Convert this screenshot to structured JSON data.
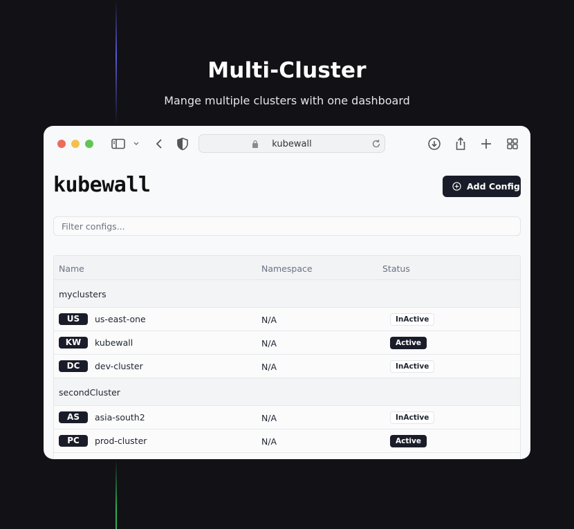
{
  "hero": {
    "title": "Multi-Cluster",
    "subtitle": "Mange multiple clusters with one dashboard"
  },
  "browser": {
    "url": "kubewall"
  },
  "app": {
    "brand": "kubewall",
    "add_config_label": "Add Config",
    "filter_placeholder": "Filter configs..."
  },
  "table": {
    "columns": [
      "Name",
      "Namespace",
      "Status"
    ],
    "groups": [
      {
        "name": "myclusters",
        "rows": [
          {
            "abbr": "US",
            "name": "us-east-one",
            "namespace": "N/A",
            "status": "InActive"
          },
          {
            "abbr": "KW",
            "name": "kubewall",
            "namespace": "N/A",
            "status": "Active"
          },
          {
            "abbr": "DC",
            "name": "dev-cluster",
            "namespace": "N/A",
            "status": "InActive"
          }
        ]
      },
      {
        "name": "secondCluster",
        "rows": [
          {
            "abbr": "AS",
            "name": "asia-south2",
            "namespace": "N/A",
            "status": "InActive"
          },
          {
            "abbr": "PC",
            "name": "prod-cluster",
            "namespace": "N/A",
            "status": "Active"
          }
        ]
      }
    ]
  },
  "colors": {
    "background": "#121116",
    "accent_dark": "#1a1d29",
    "traffic_red": "#ed6a5e",
    "traffic_yellow": "#f5bf4f",
    "traffic_green": "#61c554"
  }
}
